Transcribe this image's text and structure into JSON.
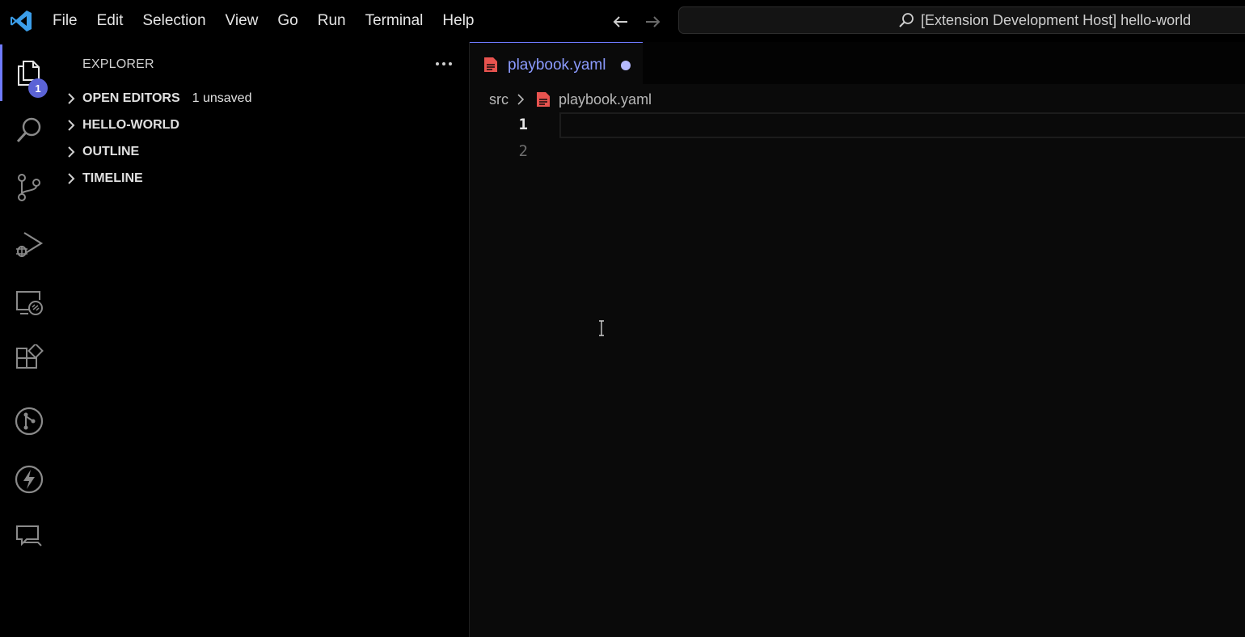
{
  "menu": [
    "File",
    "Edit",
    "Selection",
    "View",
    "Go",
    "Run",
    "Terminal",
    "Help"
  ],
  "command_center": {
    "text": "[Extension Development Host] hello-world"
  },
  "activity_bar": {
    "badge": "1",
    "items": [
      "explorer-icon",
      "search-icon",
      "source-control-icon",
      "run-debug-icon",
      "remote-explorer-icon",
      "extensions-icon",
      "git-graph-icon",
      "lightning-icon",
      "chat-icon"
    ]
  },
  "sidebar": {
    "title": "EXPLORER",
    "sections": [
      {
        "label": "OPEN EDITORS",
        "extra": "1 unsaved"
      },
      {
        "label": "HELLO-WORLD"
      },
      {
        "label": "OUTLINE"
      },
      {
        "label": "TIMELINE"
      }
    ]
  },
  "editor": {
    "tab": {
      "label": "playbook.yaml"
    },
    "breadcrumb": {
      "folder": "src",
      "file": "playbook.yaml"
    },
    "line_numbers": [
      "1",
      "2"
    ]
  },
  "colors": {
    "accent": "#6f7bff",
    "tab_label": "#8c9bff",
    "yaml_icon": "#e8534f",
    "badge": "#5b63d6"
  }
}
